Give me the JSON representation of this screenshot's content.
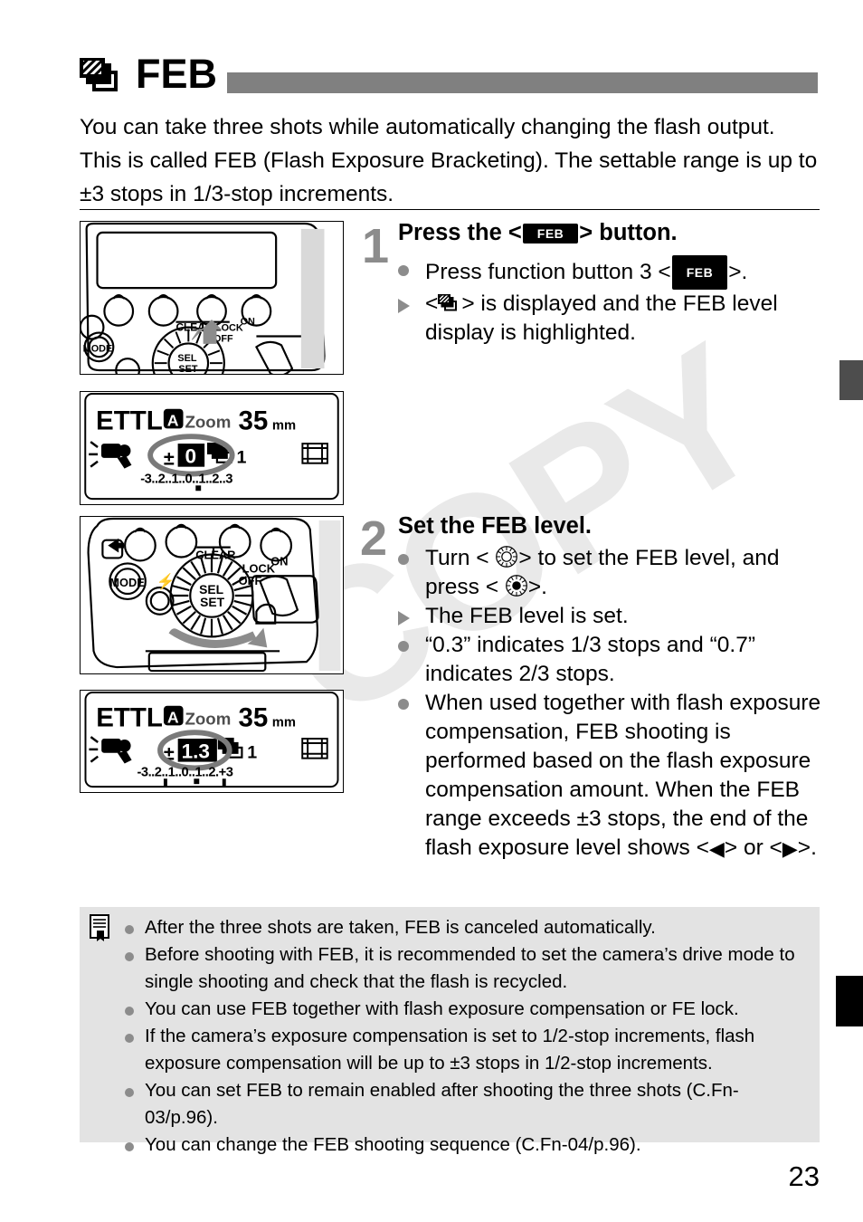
{
  "header": {
    "icon": "feb-bracketing-icon",
    "title": "FEB"
  },
  "intro": "You can take three shots while automatically changing the flash output. This is called FEB (Flash Exposure Bracketing). The settable range is up to ±3 stops in 1/3-stop increments.",
  "steps": [
    {
      "number": "1",
      "title_before": "Press the <",
      "title_key": "FEB",
      "title_after": "> button.",
      "bullets": [
        {
          "marker": "dot",
          "before": "Press function button 3 <",
          "key": "FEB",
          "after": ">."
        },
        {
          "marker": "triangle",
          "before": "<",
          "key": "bracket-icon",
          "after": "> is displayed and the FEB level display is highlighted."
        }
      ]
    },
    {
      "number": "2",
      "title": "Set the FEB level.",
      "bullets": [
        {
          "marker": "dot",
          "text_a": "Turn <",
          "icon_a": "select-dial-icon",
          "text_b": "> to set the FEB level, and press <",
          "icon_b": "set-button-icon",
          "text_c": ">."
        },
        {
          "marker": "triangle",
          "text": "The FEB level is set."
        },
        {
          "marker": "dot",
          "text": "“0.3” indicates 1/3 stops and “0.7” indicates 2/3 stops."
        },
        {
          "marker": "dot",
          "text_a": "When used together with flash exposure compensation, FEB shooting is performed based on the flash exposure compensation amount. When the FEB range exceeds ±3 stops, the end of the flash exposure level shows <",
          "glyph_a": "◀",
          "text_b": "> or <",
          "glyph_b": "▶",
          "text_c": ">."
        }
      ]
    }
  ],
  "figures": {
    "panel1": {
      "name": "flash-control-panel-button3",
      "labels": {
        "clear": "CLEAR",
        "mode": "MODE",
        "lock": "LOCK",
        "off": "OFF",
        "on": "ON",
        "sel": "SEL",
        "set": "SET"
      }
    },
    "lcd1": {
      "name": "lcd-feb-level-zero",
      "mode": "ETTL",
      "a_icon": "A",
      "zoom_label": "Zoom",
      "zoom_value": "35",
      "zoom_unit": "mm",
      "feb_sign": "±",
      "feb_value": "0",
      "shots": "1",
      "scale": "-3..2..1..0..1..2..3"
    },
    "panel2": {
      "name": "flash-control-panel-dial",
      "labels": {
        "clear": "CLEAR",
        "mode": "MODE",
        "lock": "LOCK",
        "off": "OFF",
        "on": "ON",
        "sel": "SEL",
        "set": "SET"
      }
    },
    "lcd2": {
      "name": "lcd-feb-level-one-three",
      "mode": "ETTL",
      "a_icon": "A",
      "zoom_label": "Zoom",
      "zoom_value": "35",
      "zoom_unit": "mm",
      "feb_sign": "±",
      "feb_value": "1.3",
      "shots": "1",
      "scale": "-3..2..1..0..1..2.+3"
    }
  },
  "note": {
    "icon": "note-memo-icon",
    "items": [
      "After the three shots are taken, FEB is canceled automatically.",
      "Before shooting with FEB, it is recommended to set the camera’s drive mode to single shooting and check that the flash is recycled.",
      "You can use FEB together with flash exposure compensation or FE lock.",
      "If the camera’s exposure compensation is set to 1/2-stop increments, flash exposure compensation will be up to ±3 stops in 1/2-stop increments.",
      "You can set FEB to remain enabled after shooting the three shots (C.Fn-03/p.96).",
      "You can change the FEB shooting sequence (C.Fn-04/p.96)."
    ]
  },
  "page_number": "23",
  "watermark": "COPY",
  "colors": {
    "title_bar": "#808080",
    "step_number": "#8c8c8c",
    "bullet": "#8c8c8c",
    "note_bg": "#e3e3e3",
    "key_bg": "#000000",
    "edge_tab_gray": "#4d4d4d",
    "edge_tab_black": "#000000",
    "watermark": "#e9e9e9"
  }
}
